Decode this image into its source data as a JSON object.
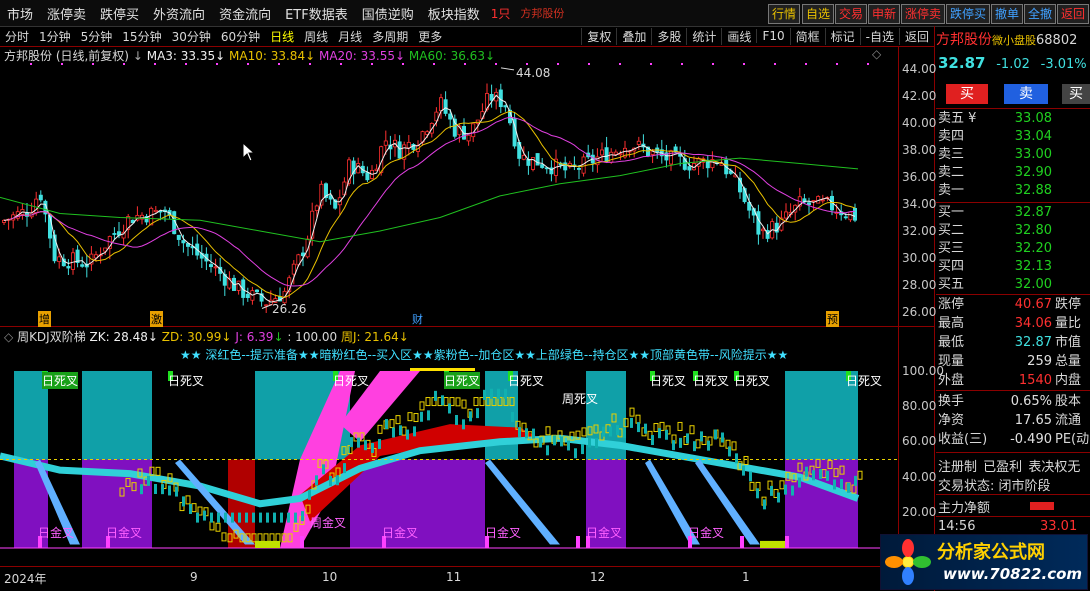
{
  "topbar": {
    "menus": [
      "市场",
      "涨停卖",
      "跌停买",
      "外资流向",
      "资金流向",
      "ETF数据表",
      "国债逆购",
      "板块指数"
    ],
    "red_marker": "1只",
    "stock_name": "方邦股份",
    "quick_buttons": [
      "行情",
      "自选",
      "交易",
      "申新",
      "涨停卖",
      "跌停买",
      "撤单",
      "全撤",
      "返回"
    ]
  },
  "subbar": {
    "periods": [
      "分时",
      "1分钟",
      "5分钟",
      "15分钟",
      "30分钟",
      "60分钟",
      "日线",
      "周线",
      "月线",
      "多周期",
      "更多"
    ],
    "active_period": "日线",
    "tools": [
      "复权",
      "叠加",
      "多股",
      "统计",
      "画线",
      "F10",
      "简框",
      "标记",
      "-自选",
      "返回"
    ]
  },
  "main_legend": {
    "title": "方邦股份 (日线,前复权)",
    "ma3": "MA3: 33.35",
    "ma10": "MA10: 33.84",
    "ma20": "MA20: 33.55",
    "ma60": "MA60: 36.63"
  },
  "colors": {
    "ma3": "#f0f0f0",
    "ma10": "#e8c000",
    "ma20": "#e040e0",
    "ma60": "#20c020",
    "up": "#ff3030",
    "down": "#40e0e0",
    "bg": "#000000",
    "grid": "#8b0000"
  },
  "price_axis": [
    "44.00",
    "42.00",
    "40.00",
    "38.00",
    "36.00",
    "34.00",
    "32.00",
    "30.00",
    "28.00",
    "26.00"
  ],
  "kdj_axis": [
    "100.00",
    "80.00",
    "60.00",
    "40.00",
    "20.00"
  ],
  "annotations": {
    "high": "44.08",
    "low": "26.26",
    "badges": [
      "增",
      "激",
      "财",
      "预"
    ]
  },
  "kdj_legend": {
    "title": "周KDJ双阶梯",
    "zk": "ZK: 28.48",
    "zd": "ZD: 30.99",
    "j": "J: 6.39",
    "hundred": ": 100.00",
    "zj": "周J: 21.64",
    "hint": "★★ 深红色--提示准备★★暗粉红色--买入区★★紫粉色--加仓区★★上部绿色--持仓区★★顶部黄色带--风险提示★★"
  },
  "kdj_labels": {
    "death": [
      "日死叉",
      "日死叉",
      "日死叉",
      "日死叉",
      "日死叉",
      "日死叉",
      "日死叉",
      "日死叉",
      "日死叉"
    ],
    "week_death": "周死叉",
    "gold": [
      "日金叉",
      "日金叉",
      "日金叉",
      "日金叉",
      "日金叉",
      "日金叉"
    ],
    "week_gold": "周金叉"
  },
  "timeline": [
    "2024年",
    "9",
    "10",
    "11",
    "12",
    "1"
  ],
  "right_panel": {
    "name": "方邦股份",
    "tag": "微小盘股",
    "code": "68802",
    "price": "32.87",
    "change": "-1.02",
    "pct": "-3.01%",
    "buy_label": "买",
    "sell_label": "卖",
    "ask": [
      {
        "label": "卖五 ¥",
        "price": "33.08"
      },
      {
        "label": "卖四",
        "price": "33.04"
      },
      {
        "label": "卖三",
        "price": "33.00"
      },
      {
        "label": "卖二",
        "price": "32.90"
      },
      {
        "label": "卖一",
        "price": "32.88"
      }
    ],
    "bid": [
      {
        "label": "买一",
        "price": "32.87"
      },
      {
        "label": "买二",
        "price": "32.80"
      },
      {
        "label": "买三",
        "price": "32.20"
      },
      {
        "label": "买四",
        "price": "32.13"
      },
      {
        "label": "买五",
        "price": "32.00"
      }
    ],
    "stats": [
      {
        "label": "涨停",
        "value": "40.67",
        "right": "跌停",
        "color": "#ff3030"
      },
      {
        "label": "最高",
        "value": "34.06",
        "right": "量比",
        "color": "#ff3030"
      },
      {
        "label": "最低",
        "value": "32.87",
        "right": "市值",
        "color": "#40e0e0"
      },
      {
        "label": "现量",
        "value": "259",
        "right": "总量",
        "color": "#e0e0e0"
      },
      {
        "label": "外盘",
        "value": "1540",
        "right": "内盘",
        "color": "#ff3030"
      }
    ],
    "stats2": [
      {
        "label": "换手",
        "value": "0.65%",
        "right": "股本"
      },
      {
        "label": "净资",
        "value": "17.65",
        "right": "流通"
      },
      {
        "label": "收益(三)",
        "value": "-0.490",
        "right": "PE(动"
      }
    ],
    "reg": "注册制",
    "profit": "已盈利",
    "vote": "表决权无",
    "trade_status": "交易状态: 闭市阶段",
    "main_net": "主力净额",
    "tick_time": "14:56",
    "tick_price": "33.01"
  },
  "watermark": {
    "brand": "分析家公式网",
    "url": "www.70822.com"
  }
}
